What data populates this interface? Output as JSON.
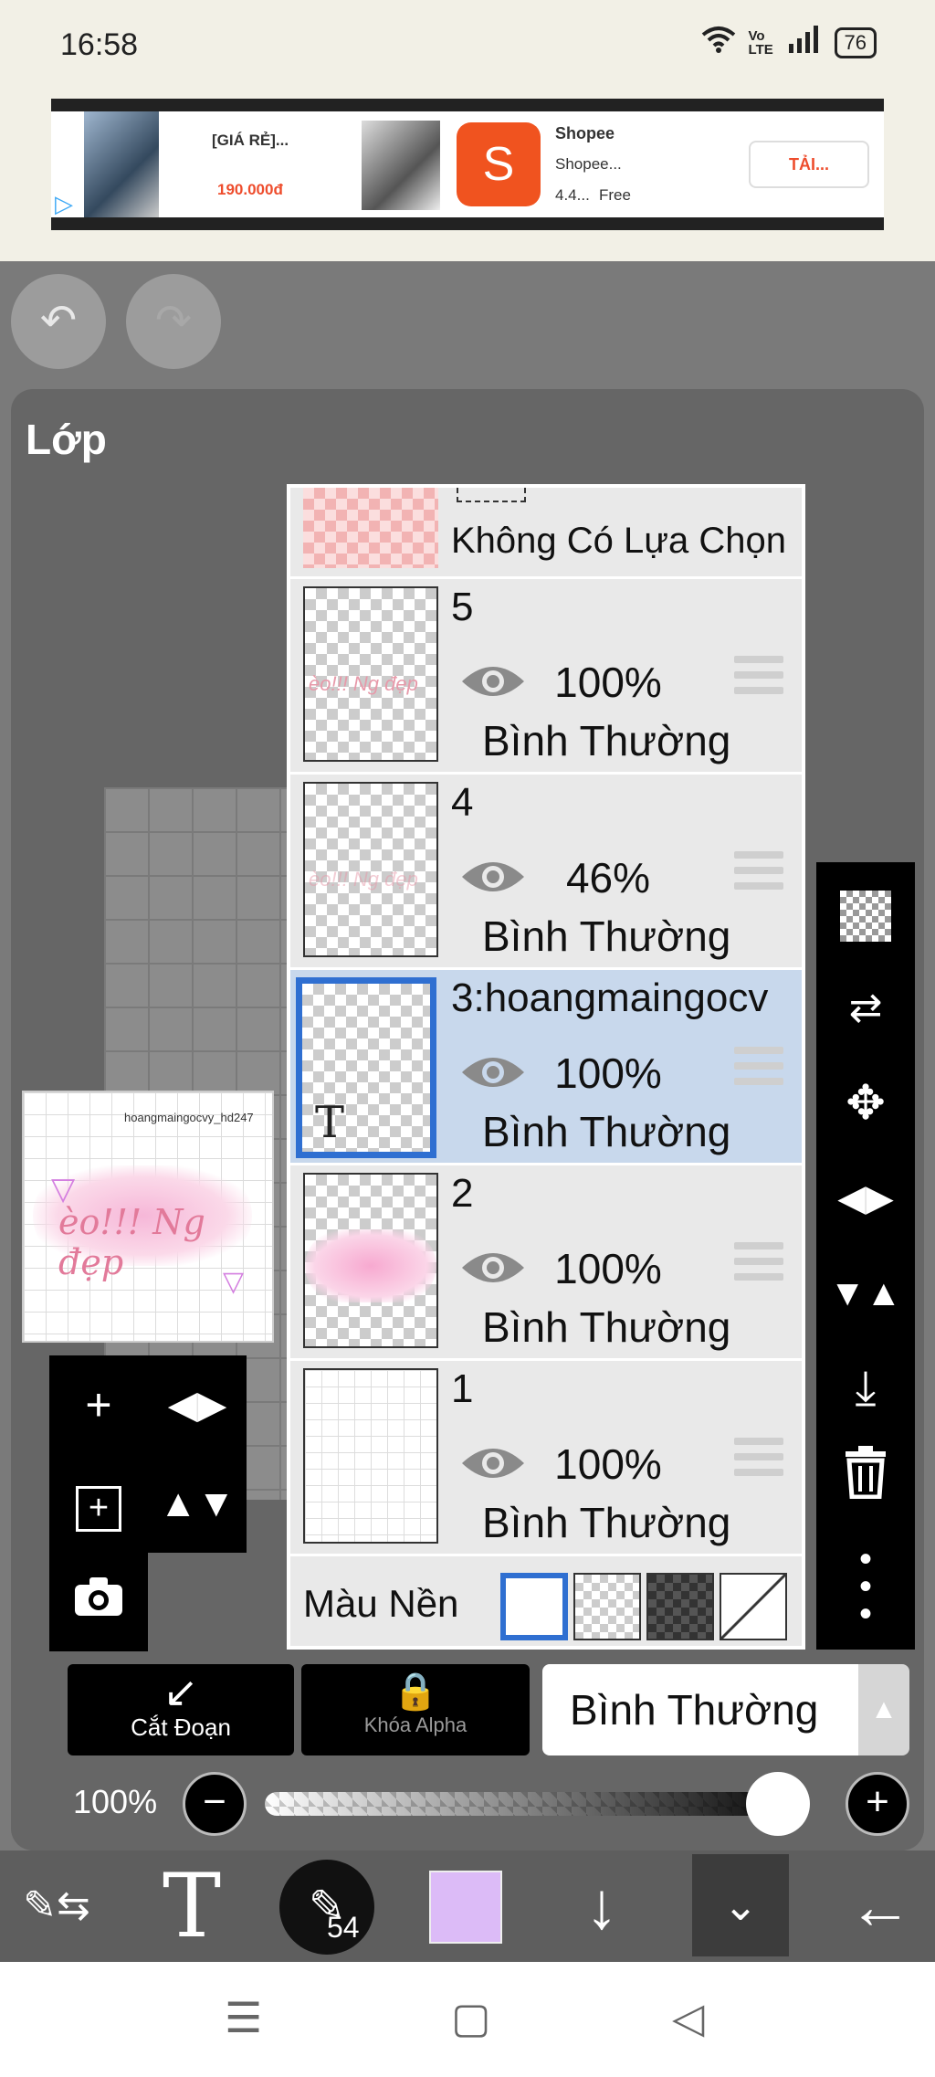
{
  "status_bar": {
    "time": "16:58",
    "battery": "76",
    "network": "Vo LTE"
  },
  "ad": {
    "product_title": "[GIÁ RẺ]...",
    "product_price": "190.000đ",
    "app_name": "Shopee",
    "app_subtitle": "Shopee...",
    "rating": "4.4...",
    "price_tag": "Free",
    "cta": "TẢI...",
    "logo_letter": "S"
  },
  "panel": {
    "title": "Lớp"
  },
  "preview": {
    "caption": "hoangmaingocvy_hd247",
    "art_text": "èo!!! Ng đẹp"
  },
  "layers": [
    {
      "name": "Không Có Lựa Chọn"
    },
    {
      "name": "5",
      "opacity": "100%",
      "blend": "Bình Thường",
      "thumb_text": "èo!!! Ng đẹp"
    },
    {
      "name": "4",
      "opacity": "46%",
      "blend": "Bình Thường",
      "thumb_text": "èo!!! Ng đẹp"
    },
    {
      "name": "3:hoangmaingocv",
      "opacity": "100%",
      "blend": "Bình Thường",
      "thumb_glyph": "T",
      "selected": true
    },
    {
      "name": "2",
      "opacity": "100%",
      "blend": "Bình Thường"
    },
    {
      "name": "1",
      "opacity": "100%",
      "blend": "Bình Thường"
    }
  ],
  "background": {
    "label": "Màu Nền"
  },
  "actions": {
    "clip_label": "Cắt Đoạn",
    "alpha_lock_label": "Khóa Alpha",
    "blend_mode": "Bình Thường"
  },
  "opacity": {
    "label": "100%",
    "value": 1.0
  },
  "toolbar": {
    "brush_size": "54",
    "color": "#dcbbf7"
  },
  "colors": {
    "selected_border": "#2f6fd1",
    "selected_row": "#c8d8ec",
    "shopee": "#f0531f"
  }
}
